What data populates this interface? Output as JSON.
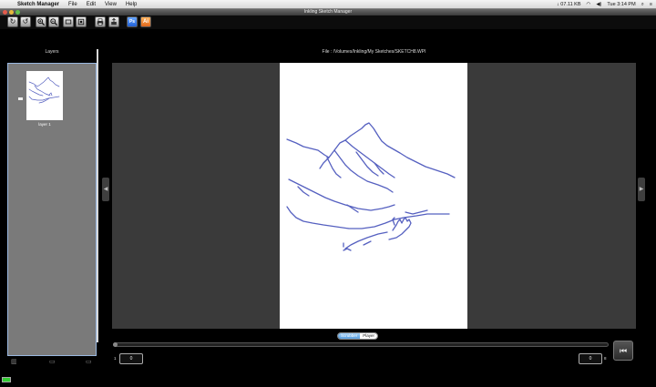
{
  "menubar": {
    "app_name": "Sketch Manager",
    "items": [
      "File",
      "Edit",
      "View",
      "Help"
    ],
    "status": {
      "speed": "↓ 07.11 KB",
      "clock": "Tue 3:14 PM"
    }
  },
  "window": {
    "title": "Inkling Sketch Manager"
  },
  "toolbar": {
    "icons": [
      "rotate-clockwise-icon",
      "rotate-counterclockwise-icon",
      "zoom-in-icon",
      "zoom-out-icon",
      "fit-width-icon",
      "fit-page-icon",
      "print-icon",
      "export-icon",
      "photoshop-icon",
      "illustrator-icon"
    ],
    "photoshop_label": "Ps",
    "illustrator_label": "Ai"
  },
  "layers": {
    "title": "Layers",
    "items": [
      {
        "label": "layer 1"
      }
    ]
  },
  "file": {
    "path_label": "File : /Volumes/Inkling/My Sketches/SKETCH8.WPI"
  },
  "mode": {
    "scrubber_label": "Scrubber",
    "player_label": "Player",
    "active": "Scrubber"
  },
  "timeline": {
    "start_label": "1",
    "start_value": "0",
    "end_value": "0",
    "end_label": "8",
    "position": 0
  },
  "colors": {
    "stroke": "#5560c0",
    "accent": "#5aa0e0",
    "panel": "#7a7a7a",
    "canvas_bg": "#3a3a3a"
  }
}
